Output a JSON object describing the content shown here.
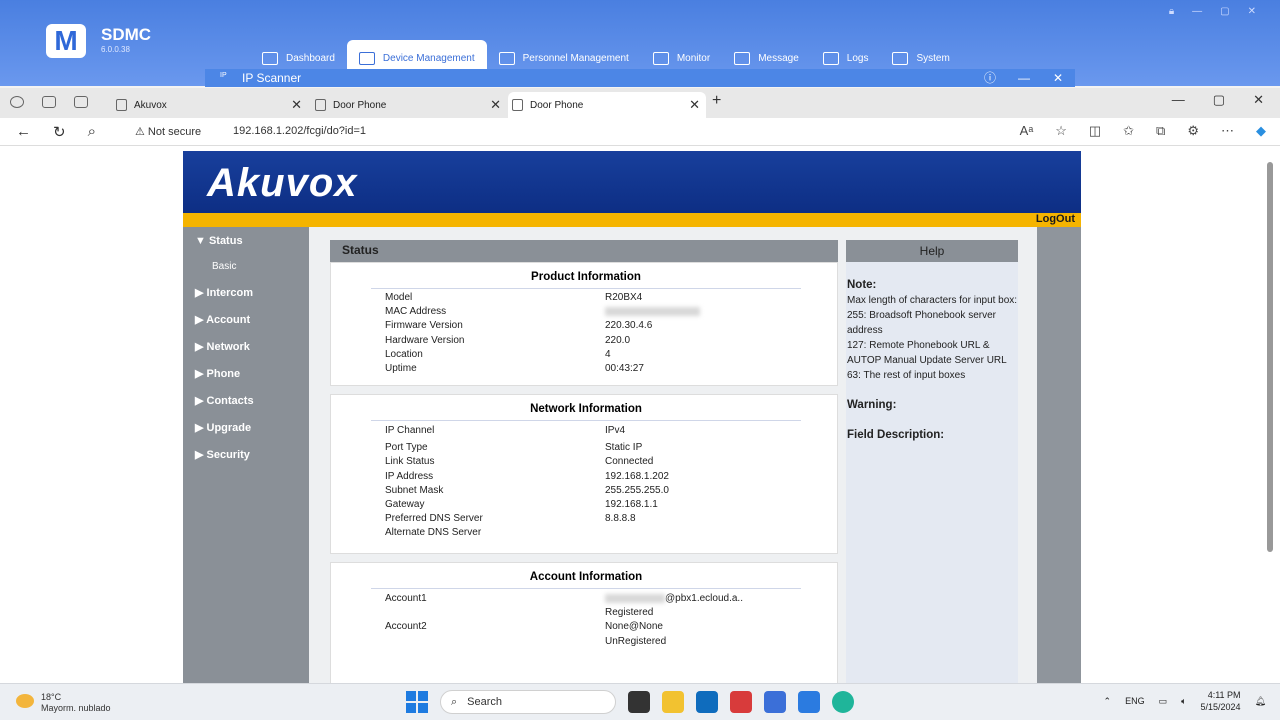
{
  "sdmc": {
    "logo_letter": "M",
    "title": "SDMC",
    "version": "6.0.0.38",
    "nav": [
      {
        "label": "Dashboard",
        "icon": "dashboard-icon"
      },
      {
        "label": "Device Management",
        "icon": "device-icon",
        "active": true
      },
      {
        "label": "Personnel Management",
        "icon": "person-icon"
      },
      {
        "label": "Monitor",
        "icon": "camera-icon"
      },
      {
        "label": "Message",
        "icon": "message-icon"
      },
      {
        "label": "Logs",
        "icon": "calendar-icon"
      },
      {
        "label": "System",
        "icon": "system-icon"
      }
    ],
    "ip_scanner": {
      "badge": "IP",
      "title": "IP Scanner",
      "minimize": "—",
      "close": "✕"
    }
  },
  "browser": {
    "tabs": [
      {
        "label": "Akuvox"
      },
      {
        "label": "Door Phone"
      },
      {
        "label": "Door Phone",
        "active": true
      }
    ],
    "new_tab": "+",
    "not_secure": "Not secure",
    "url": "192.168.1.202/fcgi/do?id=1"
  },
  "akuvox": {
    "logo": "Akuvox",
    "logout": "LogOut",
    "sidebar": [
      {
        "label": "▼ Status"
      },
      {
        "label": "Basic",
        "sub": true
      },
      {
        "label": "▶ Intercom"
      },
      {
        "label": "▶ Account"
      },
      {
        "label": "▶ Network"
      },
      {
        "label": "▶ Phone"
      },
      {
        "label": "▶ Contacts"
      },
      {
        "label": "▶ Upgrade"
      },
      {
        "label": "▶ Security"
      }
    ],
    "status_title": "Status",
    "product": {
      "heading": "Product Information",
      "rows": [
        {
          "k": "Model",
          "v": "R20BX4"
        },
        {
          "k": "MAC Address",
          "v": ""
        },
        {
          "k": "Firmware Version",
          "v": "220.30.4.6"
        },
        {
          "k": "Hardware Version",
          "v": "220.0"
        },
        {
          "k": "Location",
          "v": "4"
        },
        {
          "k": "Uptime",
          "v": "00:43:27"
        }
      ]
    },
    "network": {
      "heading": "Network Information",
      "rows": [
        {
          "k": "IP Channel",
          "v": "IPv4"
        },
        {
          "k": "Port Type",
          "v": "Static IP"
        },
        {
          "k": "Link Status",
          "v": "Connected"
        },
        {
          "k": "IP Address",
          "v": "192.168.1.202"
        },
        {
          "k": "Subnet Mask",
          "v": "255.255.255.0"
        },
        {
          "k": "Gateway",
          "v": "192.168.1.1"
        },
        {
          "k": "Preferred DNS Server",
          "v": "8.8.8.8"
        },
        {
          "k": "Alternate DNS Server",
          "v": ""
        }
      ]
    },
    "account": {
      "heading": "Account Information",
      "account1_label": "Account1",
      "account1_value": "@pbx1.ecloud.a..",
      "account1_status": "Registered",
      "account2_label": "Account2",
      "account2_value": "None@None",
      "account2_status": "UnRegistered"
    },
    "help": {
      "title": "Help",
      "note_heading": "Note:",
      "note_lines": [
        "Max length of characters for input box:",
        "255: Broadsoft Phonebook server address",
        "127: Remote Phonebook URL & AUTOP Manual Update Server URL",
        "63: The rest of input boxes"
      ],
      "warning_heading": "Warning:",
      "field_heading": "Field Description:"
    }
  },
  "taskbar": {
    "temp": "18°C",
    "weather": "Mayorm. nublado",
    "search": "Search",
    "lang": "ENG",
    "time": "4:11 PM",
    "date": "5/15/2024"
  }
}
